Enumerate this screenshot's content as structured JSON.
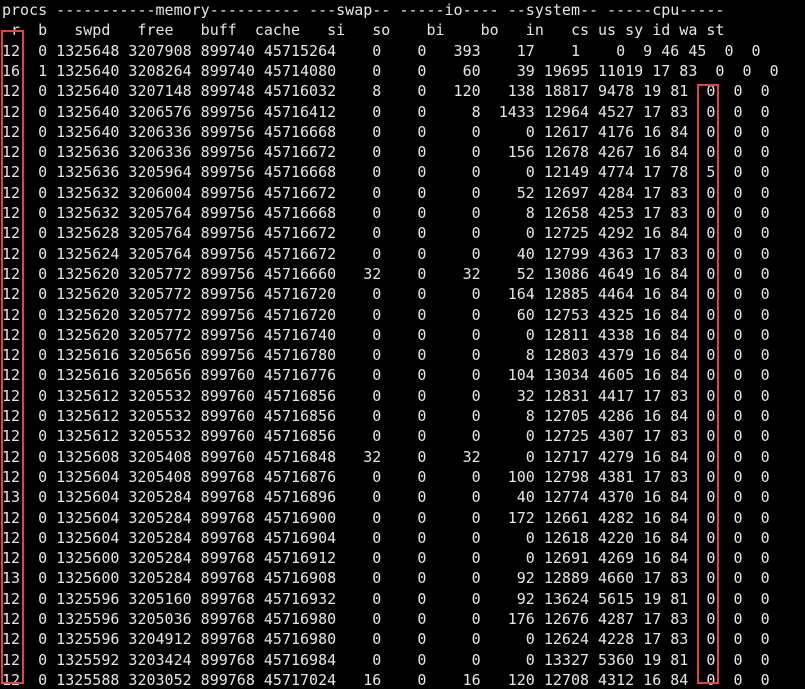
{
  "terminal": {
    "header_groups": "procs -----------memory---------- ---swap-- -----io---- --system-- -----cpu-----",
    "header_columns": " r  b   swpd   free   buff  cache   si   so    bi    bo   in   cs us sy id wa st",
    "lines": [
      "12  0 1325648 3207908 899740 45715264    0    0   393    17    1    0  9 46 45  0  0",
      "16  1 1325640 3208264 899740 45714080    0    0    60    39 19695 11019 17 83  0  0  0",
      "12  0 1325640 3207148 899748 45716032    8    0   120   138 18817 9478 19 81  0  0  0",
      "12  0 1325640 3206576 899756 45716412    0    0     8  1433 12964 4527 17 83  0  0  0",
      "12  0 1325640 3206336 899756 45716668    0    0     0     0 12617 4176 16 84  0  0  0",
      "12  0 1325636 3206336 899756 45716672    0    0     0   156 12678 4267 16 84  0  0  0",
      "12  0 1325636 3205964 899756 45716668    0    0     0     0 12149 4774 17 78  5  0  0",
      "12  0 1325632 3206004 899756 45716672    0    0     0    52 12697 4284 17 83  0  0  0",
      "12  0 1325632 3205764 899756 45716668    0    0     0     8 12658 4253 17 83  0  0  0",
      "12  0 1325628 3205764 899756 45716672    0    0     0     0 12725 4292 16 84  0  0  0",
      "12  0 1325624 3205764 899756 45716672    0    0     0    40 12799 4363 17 83  0  0  0",
      "12  0 1325620 3205772 899756 45716660   32    0    32    52 13086 4649 16 84  0  0  0",
      "12  0 1325620 3205772 899756 45716720    0    0     0   164 12885 4464 16 84  0  0  0",
      "12  0 1325620 3205772 899756 45716720    0    0     0    60 12753 4325 16 84  0  0  0",
      "12  0 1325620 3205772 899756 45716740    0    0     0     0 12811 4338 16 84  0  0  0",
      "12  0 1325616 3205656 899756 45716780    0    0     0     8 12803 4379 16 84  0  0  0",
      "12  0 1325616 3205656 899760 45716776    0    0     0   104 13034 4605 16 84  0  0  0",
      "12  0 1325612 3205532 899760 45716856    0    0     0    32 12831 4417 17 83  0  0  0",
      "12  0 1325612 3205532 899760 45716856    0    0     0     8 12705 4286 16 84  0  0  0",
      "12  0 1325612 3205532 899760 45716856    0    0     0     0 12725 4307 17 83  0  0  0",
      "12  0 1325608 3205408 899760 45716848   32    0    32     0 12717 4279 16 84  0  0  0",
      "12  0 1325604 3205408 899768 45716876    0    0     0   100 12798 4381 17 83  0  0  0",
      "13  0 1325604 3205284 899768 45716896    0    0     0    40 12774 4370 16 84  0  0  0",
      "12  0 1325604 3205284 899768 45716900    0    0     0   172 12661 4282 16 84  0  0  0",
      "12  0 1325604 3205284 899768 45716904    0    0     0     0 12618 4220 16 84  0  0  0",
      "12  0 1325600 3205284 899768 45716912    0    0     0     0 12691 4269 16 84  0  0  0",
      "13  0 1325600 3205284 899768 45716908    0    0     0    92 12889 4660 17 83  0  0  0",
      "12  0 1325596 3205160 899768 45716932    0    0     0    92 13624 5615 19 81  0  0  0",
      "12  0 1325596 3205036 899768 45716980    0    0     0   176 12676 4287 17 83  0  0  0",
      "12  0 1325596 3204912 899768 45716980    0    0     0     0 12624 4228 17 83  0  0  0",
      "12  0 1325592 3203424 899768 45716984    0    0     0     0 13327 5360 19 81  0  0  0",
      "12  0 1325588 3203052 899768 45717024   16    0    16   120 12708 4312 16 84  0  0  0"
    ]
  },
  "highlights": {
    "r_column": "r",
    "wa_column": "wa"
  },
  "colors": {
    "background": "#000000",
    "text": "#e6e6e6",
    "highlight_box": "#e0434b"
  }
}
